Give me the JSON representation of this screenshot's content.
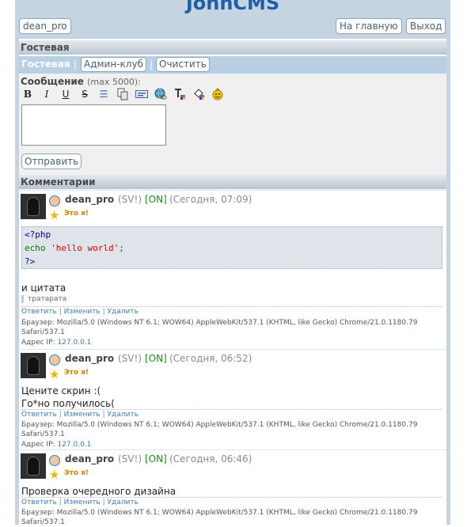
{
  "header": {
    "logo": "JohnCMS",
    "user_button": "dean_pro",
    "home_button": "На главную",
    "exit_button": "Выход"
  },
  "guestbook": {
    "title": "Гостевая",
    "tab_active": "Гостевая",
    "separator": "|",
    "tab_admin": "Админ-клуб",
    "tab_clear": "Очистить"
  },
  "form": {
    "label": "Сообщение",
    "max": "(max 5000):",
    "toolbar": [
      "bold-icon",
      "italic-icon",
      "underline-icon",
      "strike-icon",
      "list-icon",
      "copy-icon",
      "php-icon",
      "link-icon",
      "text-color-icon",
      "fill-color-icon",
      "smile-icon"
    ],
    "textarea_value": "",
    "submit": "Отправить"
  },
  "comments_title": "Комментарии",
  "comments": [
    {
      "author": "dean_pro",
      "status": "(SV!)",
      "online": "[ON]",
      "time": "(Сегодня, 07:09)",
      "badge": "Это я!",
      "code": [
        "<?php",
        "echo",
        "'hello world'",
        ";",
        "?>"
      ],
      "text": "и цитата",
      "quote": "тратарата",
      "reply": "Ответить",
      "edit": "Изменить",
      "delete": "Удалить",
      "pipe": "|",
      "browser_label": "Браузер:",
      "browser": "Mozilla/5.0 (Windows NT 6.1; WOW64) AppleWebKit/537.1 (KHTML, like Gecko) Chrome/21.0.1180.79 Safari/537.1",
      "ip_label": "Адрес IP:",
      "ip": "127.0.0.1"
    },
    {
      "author": "dean_pro",
      "status": "(SV!)",
      "online": "[ON]",
      "time": "(Сегодня, 06:52)",
      "badge": "Это я!",
      "text1": "Цените скрин :(",
      "text2": "Го*но получилось(",
      "reply": "Ответить",
      "edit": "Изменить",
      "delete": "Удалить",
      "pipe": "|",
      "browser_label": "Браузер:",
      "browser": "Mozilla/5.0 (Windows NT 6.1; WOW64) AppleWebKit/537.1 (KHTML, like Gecko) Chrome/21.0.1180.79 Safari/537.1",
      "ip_label": "Адрес IP:",
      "ip": "127.0.0.1"
    },
    {
      "author": "dean_pro",
      "status": "(SV!)",
      "online": "[ON]",
      "time": "(Сегодня, 06:46)",
      "badge": "Это я!",
      "text": "Проверка очередного дизайна",
      "reply": "Ответить",
      "edit": "Изменить",
      "delete": "Удалить",
      "pipe": "|",
      "browser_label": "Браузер:",
      "browser": "Mozilla/5.0 (Windows NT 6.1; WOW64) AppleWebKit/537.1 (KHTML, like Gecko) Chrome/21.0.1180.79 Safari/537.1"
    }
  ]
}
